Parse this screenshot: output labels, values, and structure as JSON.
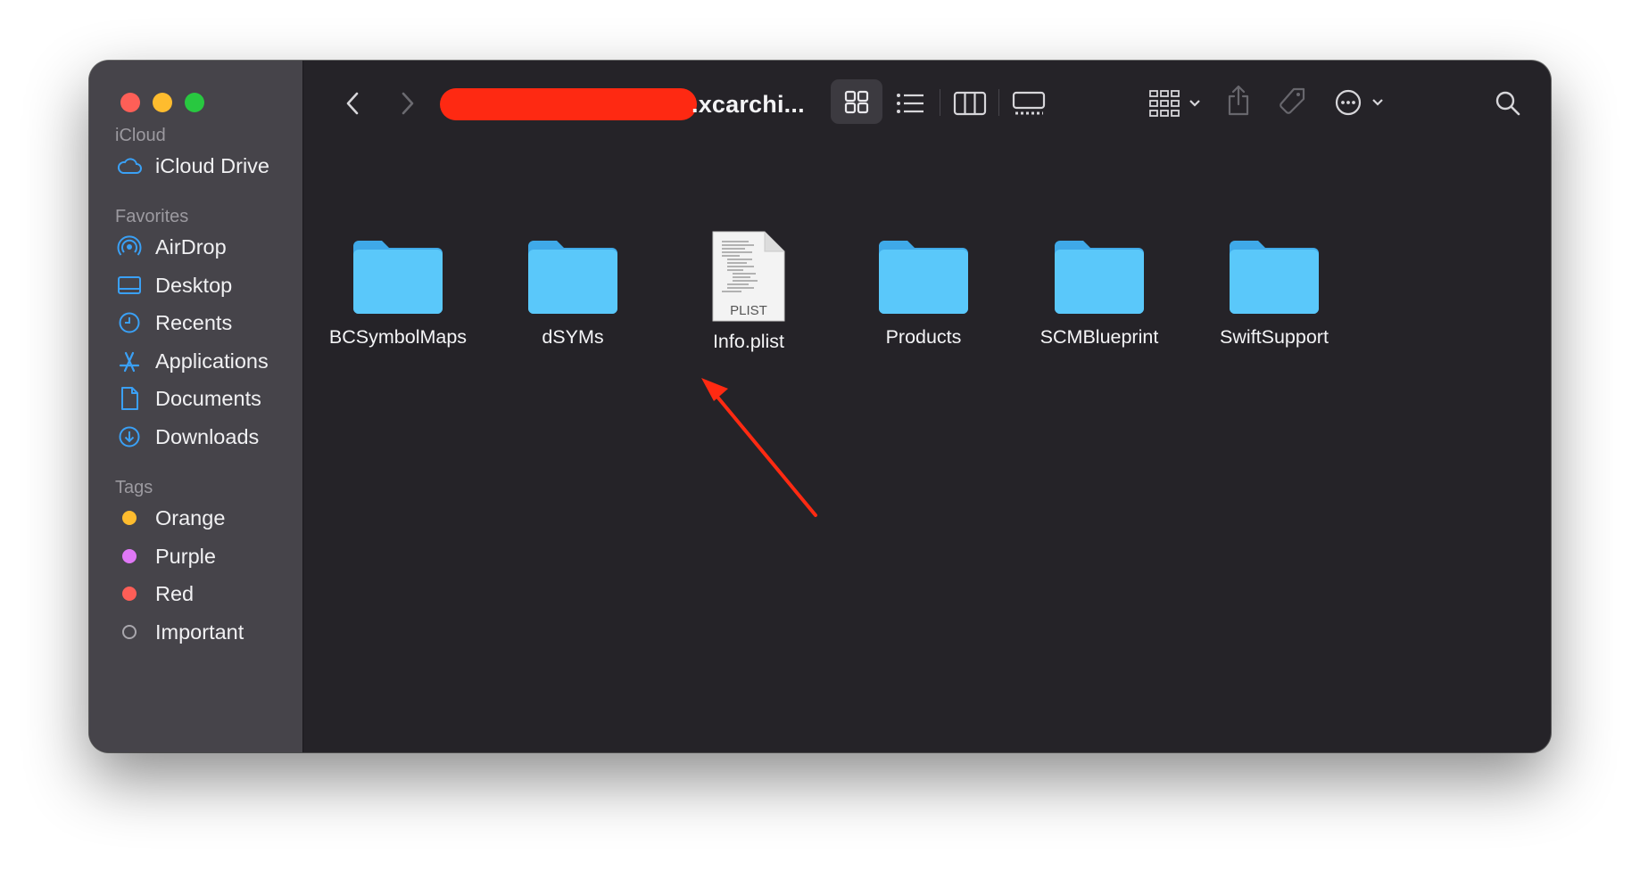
{
  "window": {
    "title_suffix": ".xcarchi..."
  },
  "sidebar": {
    "sections": [
      {
        "label": "iCloud"
      },
      {
        "label": "Favorites"
      },
      {
        "label": "Tags"
      }
    ],
    "icloud_items": [
      {
        "label": "iCloud Drive",
        "icon": "cloud-icon"
      }
    ],
    "favorites": [
      {
        "label": "AirDrop",
        "icon": "airdrop-icon"
      },
      {
        "label": "Desktop",
        "icon": "desktop-icon"
      },
      {
        "label": "Recents",
        "icon": "clock-icon"
      },
      {
        "label": "Applications",
        "icon": "applications-icon"
      },
      {
        "label": "Documents",
        "icon": "document-icon"
      },
      {
        "label": "Downloads",
        "icon": "download-icon"
      }
    ],
    "tags": [
      {
        "label": "Orange",
        "color": "#febc2e"
      },
      {
        "label": "Purple",
        "color": "#e078f6"
      },
      {
        "label": "Red",
        "color": "#fd5e57"
      },
      {
        "label": "Important",
        "color": "none"
      }
    ]
  },
  "files": [
    {
      "name": "BCSymbolMaps",
      "kind": "folder"
    },
    {
      "name": "dSYMs",
      "kind": "folder"
    },
    {
      "name": "Info.plist",
      "kind": "plist",
      "badge": "PLIST"
    },
    {
      "name": "Products",
      "kind": "folder"
    },
    {
      "name": "SCMBlueprint",
      "kind": "folder"
    },
    {
      "name": "SwiftSupport",
      "kind": "folder"
    }
  ],
  "colors": {
    "folder": "#5ac8fa",
    "accent_icon": "#3aa0f5",
    "annotation_arrow": "#ff2a12"
  }
}
